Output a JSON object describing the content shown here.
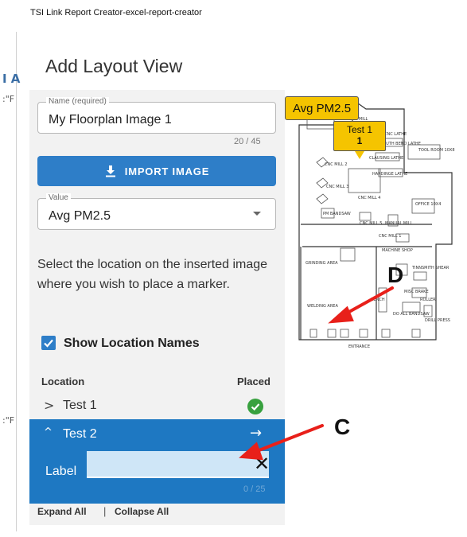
{
  "window": {
    "title": "TSI Link Report Creator-excel-report-creator"
  },
  "background_fragments": {
    "a": "I A",
    "b": ":\"F",
    "c": ":\"F"
  },
  "dialog": {
    "title": "Add Layout View"
  },
  "name_field": {
    "label": "Name (required)",
    "value": "My Floorplan Image 1",
    "counter": "20 / 45"
  },
  "import_button": {
    "label": "IMPORT IMAGE",
    "icon": "download-icon"
  },
  "value_field": {
    "label": "Value",
    "selected": "Avg PM2.5",
    "icon": "chevron-down-icon"
  },
  "instructions": "Select the location on the inserted image where you wish to place a marker.",
  "show_names": {
    "label": "Show Location Names",
    "checked": true
  },
  "table": {
    "headers": {
      "location": "Location",
      "placed": "Placed"
    },
    "rows": [
      {
        "name": "Test 1",
        "expanded": false,
        "placed": true,
        "icon": "check-circle-icon"
      },
      {
        "name": "Test 2",
        "expanded": true,
        "placed": false,
        "icon": "arrow-right-icon",
        "label_caption": "Label",
        "label_value": "",
        "label_counter": "0 / 25"
      }
    ]
  },
  "links": {
    "expand_all": "Expand All",
    "separator": "|",
    "collapse_all": "Collapse All"
  },
  "floorplan": {
    "rooms": [
      "RADIAL CNC MILL 3 AXIS MILL",
      "CNC LATHE",
      "SOUTH BEND LATHE",
      "CNC MILL 2",
      "CLAUSING LATHE",
      "HARDINGE LATHE",
      "TOOL ROOM 10X8",
      "CNC MILL 3",
      "CNC MILL 4",
      "OFFICE 10X4",
      "PM BANDSAW",
      "CNC MILL 5",
      "MANUAL MILL",
      "CNC MILL 1",
      "MACHINE SHOP",
      "GRINDING AREA",
      "TINNSMITH SHEAR",
      "MISC BRAKE",
      "ROLLER",
      "WELDING AREA",
      "BENCH",
      "DO ALL BANDSAW",
      "DRILL PRESS",
      "ENTRANCE"
    ],
    "markers": [
      {
        "name": "Avg PM2.5"
      },
      {
        "name": "Test 1",
        "value": "1"
      }
    ]
  },
  "callouts": {
    "d": "D",
    "c": "C"
  },
  "colors": {
    "primary": "#2e7ec8",
    "selected_row": "#1e78c2",
    "marker": "#f5c400",
    "success": "#38a13f",
    "annotation_arrow": "#e8201a"
  }
}
